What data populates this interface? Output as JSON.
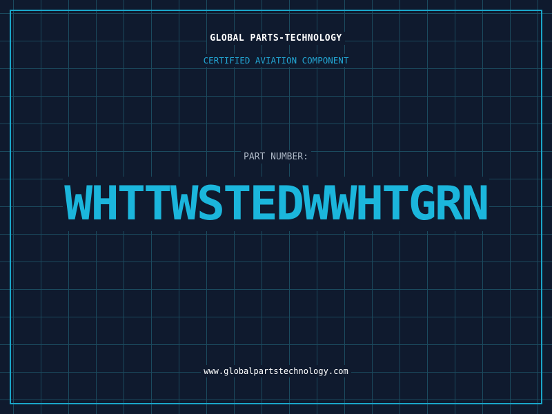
{
  "header": {
    "company_name": "GLOBAL PARTS-TECHNOLOGY",
    "certification": "CERTIFIED AVIATION COMPONENT"
  },
  "part": {
    "label": "PART NUMBER:",
    "number": "WHTTWSTEDWWHTGRN"
  },
  "footer": {
    "website": "www.globalpartstechnology.com"
  },
  "colors": {
    "background": "#0f1a2e",
    "grid": "#1b4a5e",
    "accent": "#1bb6dc",
    "frame": "#1aa6c9"
  }
}
